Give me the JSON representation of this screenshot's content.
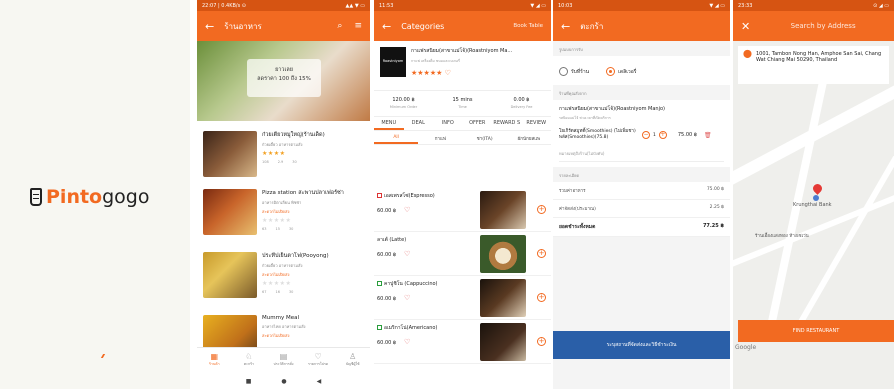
{
  "splash": {
    "brand_orange": "Pinto",
    "brand_black": "gogo",
    "accent": "#f26a21"
  },
  "list": {
    "status_time": "22:07 | 0.4KB/s ⊙",
    "status_right": "▲▲ ▼ ▭",
    "title": "ร้านอาหาร",
    "banner_line1": "ยาวเลย",
    "banner_line2": "ลดราคา 100 ถึง 15%",
    "restaurants": [
      {
        "name": "ก๋วยเตี๋ยวหมูใหญ่(ร้านเด็ด)",
        "sub": "ก๋วยเตี๋ยว อาหารตามสั่ง",
        "status": "",
        "stars": "★★★★",
        "stats": [
          "108",
          "2.9",
          "30"
        ]
      },
      {
        "name": "Pizza station สะพานปลาเฟอร์ซ่า",
        "sub": "อาหารอิตาเลียน พิซซ่า",
        "status": "สะดวกไม่เปิดส่ง",
        "stars": "★★★★★",
        "stats": [
          "63",
          "15",
          "30"
        ]
      },
      {
        "name": "ประทีปเย็นตาโฟ(Pooyong)",
        "sub": "ก๋วยเตี๋ยว อาหารตามสั่ง",
        "status": "สะดวกไม่เปิดส่ง",
        "stars": "★★★★★",
        "stats": [
          "67",
          "16",
          "30"
        ]
      },
      {
        "name": "Mummy Meal",
        "sub": "อาหารไทย อาหารตามสั่ง",
        "status": "สะดวกไม่เปิดส่ง",
        "stars": "",
        "stats": []
      }
    ],
    "nav": [
      {
        "icon": "▦",
        "label": "ร้านค้า"
      },
      {
        "icon": "♘",
        "label": "ตะกร้า"
      },
      {
        "icon": "▤",
        "label": "ประวัติการสั่ง"
      },
      {
        "icon": "♡",
        "label": "รายการโปรด"
      },
      {
        "icon": "♙",
        "label": "บัญชีผู้ใช้"
      }
    ],
    "sys": [
      "■",
      "●",
      "◀"
    ]
  },
  "menu": {
    "status_time": "11:53",
    "status_right": "▼ ◢ ▭",
    "title": "Categories",
    "book": "Book Table",
    "store_logo": "Roastniyom",
    "store_name": "กาแฟรสนิยม(สาขาแม่โจ้)(Roastniyom Ma...",
    "store_sub": "กาแฟ เครื่องดื่ม ขนมและเบเกอรี่",
    "store_stars": "★★★★★",
    "metrics": [
      {
        "value": "120.00 ฿",
        "label": "Minimum Order"
      },
      {
        "value": "15 mins",
        "label": "Time"
      },
      {
        "value": "0.00 ฿",
        "label": "Delivery Fee"
      }
    ],
    "tabs": [
      "MENU",
      "DEAL",
      "INFO",
      "OFFER",
      "REWARD S",
      "REVIEW"
    ],
    "subtabs": [
      "All",
      "กาแฟ",
      "ชา(ITA)",
      "ผักนักยสแพ"
    ],
    "items": [
      {
        "name": "เอสเพรสโซ่(Espresso)",
        "price": "60.00 ฿",
        "veg": false
      },
      {
        "name": "ลาเต้ (Latte)",
        "price": "60.00 ฿",
        "veg": false
      },
      {
        "name": "คาปูชิโน (Cappuccino)",
        "price": "60.00 ฿",
        "veg": true
      },
      {
        "name": "อเมริกาโน่(Americano)",
        "price": "60.00 ฿",
        "veg": true
      }
    ]
  },
  "cart": {
    "status_time": "10:03",
    "status_right": "▼ ◢ ▭",
    "title": "ตะกร้า",
    "delivery_label": "รูปแบบการรับ",
    "opt_pickup": "รับที่ร้าน",
    "opt_delivery": "เดลิเวอรี่",
    "store_section": "ร้านที่คุณสั่งจาก",
    "store_name": "กาแฟรสนิยม(สาขาแม่โจ้)(Roastniyom Manjo)",
    "store_sub": "รสนิยมแม่โจ้ ช่วงเวลาที่เปิดบริการ",
    "line_desc": "โยเกิร์ตสมูทตี้(Smoothies) (ไม่เพิ่มชา) พลัส(Smoothies)(75.8) ",
    "qty": "1",
    "line_amt": "75.00 ฿",
    "note": "หมายเหตุถึงร้าน(ไม่บังคับ)",
    "summary_label": "รายละเอียด",
    "summary": [
      {
        "label": "รวมค่าอาหาร",
        "value": "75.00 ฿"
      },
      {
        "label": "ค่าจัดส่ง(ประมาณ)",
        "value": "2.25 ฿"
      }
    ],
    "total_label": "ยอดชำระทั้งหมด",
    "total_value": "77.25 ฿",
    "button": "ระบุสถานที่จัดส่งและวิธีชำระเงิน"
  },
  "map": {
    "status_time": "23:33",
    "status_right": "⊙ ◢ ▭",
    "title": "Search by Address",
    "address": "1001, Tambon Nong Han, Amphoe San Sai, Chang Wat Chiang Mai 50290, Thailand",
    "bank": "Krungthai Bank",
    "shop": "ร้านเอื้องแสงทอง ห้างเซเว่น",
    "find": "FIND RESTAURANT",
    "google": "Google"
  }
}
